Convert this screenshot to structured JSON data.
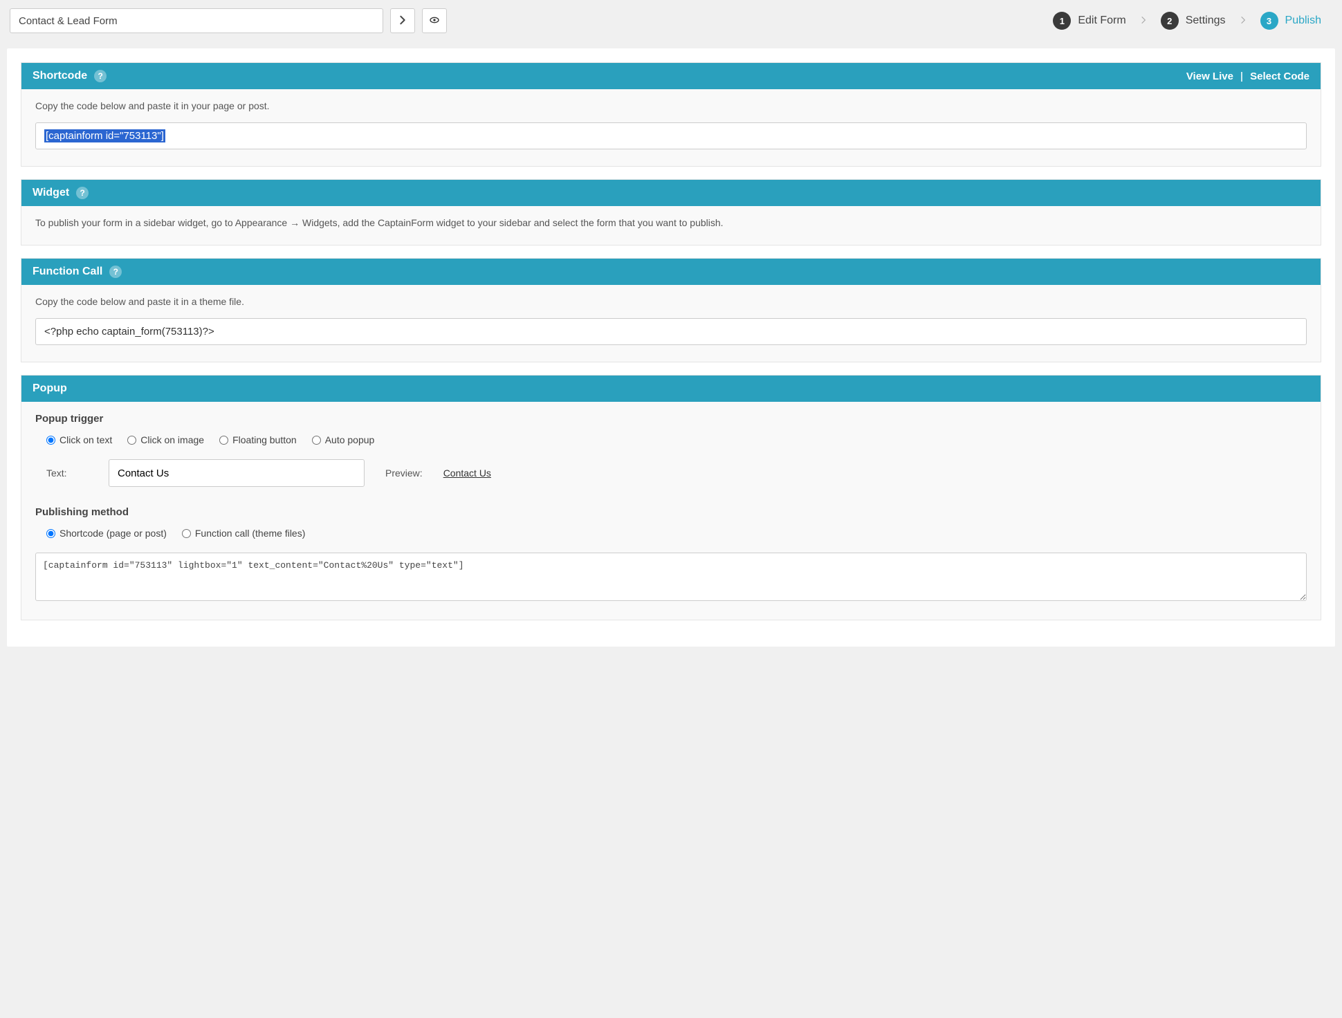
{
  "header": {
    "form_name": "Contact & Lead Form",
    "steps": [
      {
        "num": "1",
        "label": "Edit Form"
      },
      {
        "num": "2",
        "label": "Settings"
      },
      {
        "num": "3",
        "label": "Publish"
      }
    ]
  },
  "shortcode": {
    "title": "Shortcode",
    "view_live": "View Live",
    "select_code": "Select Code",
    "instruction": "Copy the code below and paste it in your page or post.",
    "code": "[captainform id=\"753113\"]"
  },
  "widget": {
    "title": "Widget",
    "text": "To publish your form in a sidebar widget, go to Appearance → Widgets, add the CaptainForm widget to your sidebar and select the form that you want to publish."
  },
  "function_call": {
    "title": "Function Call",
    "instruction": "Copy the code below and paste it in a theme file.",
    "code": "<?php echo captain_form(753113)?>"
  },
  "popup": {
    "title": "Popup",
    "trigger_label": "Popup trigger",
    "triggers": {
      "text": "Click on text",
      "image": "Click on image",
      "floating": "Floating button",
      "auto": "Auto popup"
    },
    "text_label": "Text:",
    "text_value": "Contact Us",
    "preview_label": "Preview:",
    "preview_link": "Contact Us",
    "publishing_label": "Publishing method",
    "publishing": {
      "shortcode": "Shortcode (page or post)",
      "function": "Function call (theme files)"
    },
    "shortcode_output": "[captainform id=\"753113\" lightbox=\"1\" text_content=\"Contact%20Us\" type=\"text\"]"
  }
}
